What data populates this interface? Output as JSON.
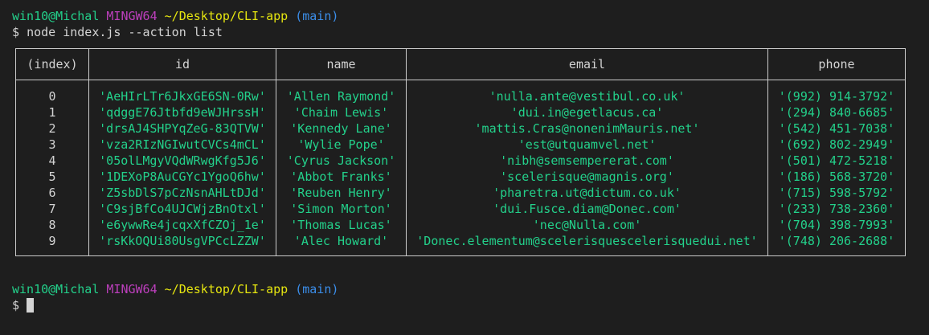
{
  "prompt": {
    "user_host": "win10@Michal",
    "env": "MINGW64",
    "path": "~/Desktop/CLI-app",
    "branch": "(main)",
    "symbol": "$"
  },
  "command": "node index.js --action list",
  "table": {
    "columns": [
      "(index)",
      "id",
      "name",
      "email",
      "phone"
    ],
    "rows": [
      {
        "index": "0",
        "id": "'AeHIrLTr6JkxGE6SN-0Rw'",
        "name": "'Allen Raymond'",
        "email": "'nulla.ante@vestibul.co.uk'",
        "phone": "'(992) 914-3792'"
      },
      {
        "index": "1",
        "id": "'qdggE76Jtbfd9eWJHrssH'",
        "name": "'Chaim Lewis'",
        "email": "'dui.in@egetlacus.ca'",
        "phone": "'(294) 840-6685'"
      },
      {
        "index": "2",
        "id": "'drsAJ4SHPYqZeG-83QTVW'",
        "name": "'Kennedy Lane'",
        "email": "'mattis.Cras@nonenimMauris.net'",
        "phone": "'(542) 451-7038'"
      },
      {
        "index": "3",
        "id": "'vza2RIzNGIwutCVCs4mCL'",
        "name": "'Wylie Pope'",
        "email": "'est@utquamvel.net'",
        "phone": "'(692) 802-2949'"
      },
      {
        "index": "4",
        "id": "'05olLMgyVQdWRwgKfg5J6'",
        "name": "'Cyrus Jackson'",
        "email": "'nibh@semsempererat.com'",
        "phone": "'(501) 472-5218'"
      },
      {
        "index": "5",
        "id": "'1DEXoP8AuCGYc1YgoQ6hw'",
        "name": "'Abbot Franks'",
        "email": "'scelerisque@magnis.org'",
        "phone": "'(186) 568-3720'"
      },
      {
        "index": "6",
        "id": "'Z5sbDlS7pCzNsnAHLtDJd'",
        "name": "'Reuben Henry'",
        "email": "'pharetra.ut@dictum.co.uk'",
        "phone": "'(715) 598-5792'"
      },
      {
        "index": "7",
        "id": "'C9sjBfCo4UJCWjzBnOtxl'",
        "name": "'Simon Morton'",
        "email": "'dui.Fusce.diam@Donec.com'",
        "phone": "'(233) 738-2360'"
      },
      {
        "index": "8",
        "id": "'e6ywwRe4jcqxXfCZOj_1e'",
        "name": "'Thomas Lucas'",
        "email": "'nec@Nulla.com'",
        "phone": "'(704) 398-7993'"
      },
      {
        "index": "9",
        "id": "'rsKkOQUi80UsgVPCcLZZW'",
        "name": "'Alec Howard'",
        "email": "'Donec.elementum@scelerisquescelerisquedui.net'",
        "phone": "'(748) 206-2688'"
      }
    ]
  },
  "colors": {
    "background": "#1e1e1e",
    "user_host": "#23d18b",
    "env": "#bc3fbc",
    "path": "#e5e510",
    "branch": "#3b8eea",
    "string_value": "#23d18b",
    "text": "#d4d4d4"
  }
}
